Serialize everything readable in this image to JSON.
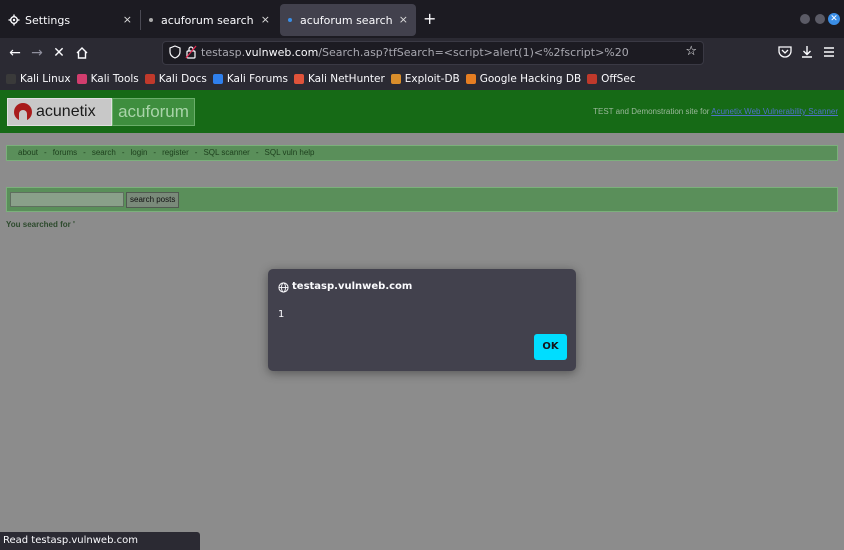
{
  "browser": {
    "tabs": [
      {
        "label": "Settings",
        "close": "×"
      },
      {
        "label": "acuforum search",
        "close": "×"
      },
      {
        "label": "acuforum search",
        "close": "×"
      }
    ],
    "new_tab": "+",
    "url": {
      "prefix": "testasp.",
      "host": "vulnweb.com",
      "path": "/Search.asp?tfSearch=<script>alert(1)<%2fscript>%20"
    },
    "bookmarks": [
      {
        "label": "Kali Linux",
        "color": "#3a3a3a"
      },
      {
        "label": "Kali Tools",
        "color": "#d23d6e"
      },
      {
        "label": "Kali Docs",
        "color": "#c0392b"
      },
      {
        "label": "Kali Forums",
        "color": "#2f80ed"
      },
      {
        "label": "Kali NetHunter",
        "color": "#e0533a"
      },
      {
        "label": "Exploit-DB",
        "color": "#d98e2b"
      },
      {
        "label": "Google Hacking DB",
        "color": "#e67e22"
      },
      {
        "label": "OffSec",
        "color": "#c0392b"
      }
    ],
    "status": "Read testasp.vulnweb.com"
  },
  "site": {
    "logo_left": "acunetix",
    "logo_right": "acuforum",
    "tagline_prefix": "TEST and Demonstration site for",
    "tagline_link": "Acunetix Web Vulnerability Scanner",
    "menu": [
      "about",
      "forums",
      "search",
      "login",
      "register",
      "SQL scanner",
      "SQL vuln help"
    ],
    "menu_sep": "-",
    "search_input_value": "",
    "search_button": "search posts",
    "searched_for": "You searched for '"
  },
  "dialog": {
    "title": "testasp.vulnweb.com",
    "message": "1",
    "ok": "OK"
  },
  "colors": {
    "accent": "#00ddff",
    "header_green": "#166a16"
  }
}
